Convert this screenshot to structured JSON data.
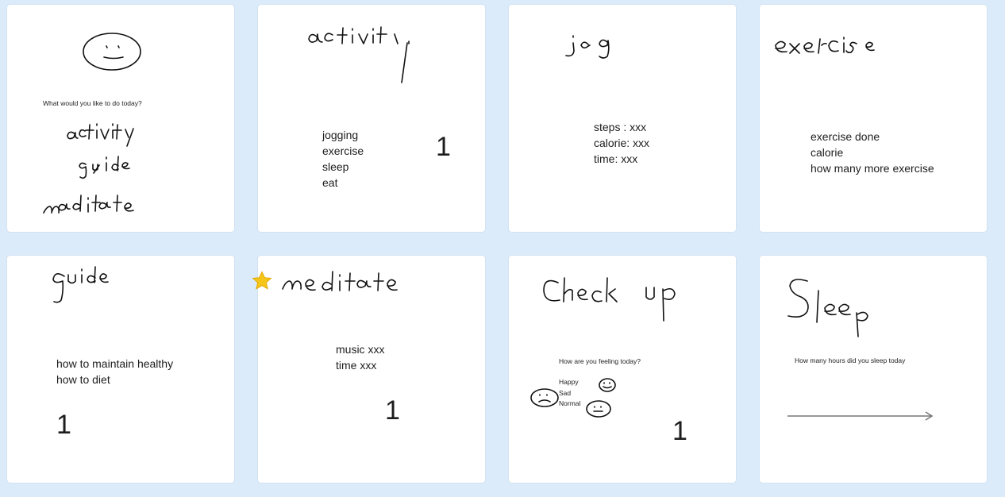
{
  "card_home": {
    "prompt": "What would you like to do today?"
  },
  "card_activity": {
    "items": [
      "jogging",
      "exercise",
      "sleep",
      "eat"
    ],
    "number": "1"
  },
  "card_jog": {
    "lines": [
      "steps : xxx",
      "calorie: xxx",
      "time: xxx"
    ]
  },
  "card_exercise": {
    "lines": [
      "exercise done",
      "calorie",
      "how many more exercise"
    ]
  },
  "card_guide": {
    "lines": [
      "how to maintain healthy",
      "how to diet"
    ],
    "number": "1"
  },
  "card_meditate": {
    "lines": [
      "music xxx",
      "time xxx"
    ],
    "number": "1"
  },
  "card_checkup": {
    "prompt": "How are you feeling today?",
    "moods": [
      "Happy",
      "Sad",
      "Normal"
    ],
    "number": "1"
  },
  "card_sleep": {
    "prompt": "How many hours did you sleep today"
  },
  "colors": {
    "background": "#dcebfa",
    "card": "#ffffff",
    "star": "#f5c518"
  }
}
